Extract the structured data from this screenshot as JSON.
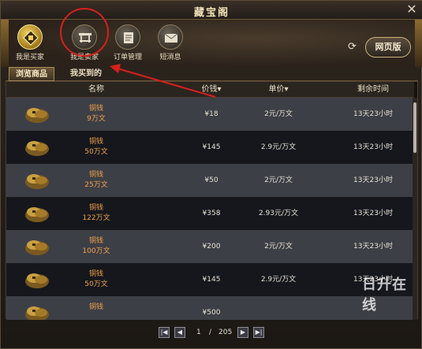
{
  "window": {
    "title": "藏宝阁",
    "close_glyph": "✕"
  },
  "toolbar": {
    "buttons": [
      {
        "label": "我是买家",
        "icon": "coin-icon",
        "active": true
      },
      {
        "label": "我是卖家",
        "icon": "stall-icon",
        "active": false
      },
      {
        "label": "订单管理",
        "icon": "book-icon",
        "active": false
      },
      {
        "label": "短消息",
        "icon": "envelope-icon",
        "active": false
      }
    ],
    "refresh_glyph": "⟳",
    "web_label": "网页版"
  },
  "tabs": [
    {
      "label": "浏览商品",
      "active": true
    },
    {
      "label": "我买到的",
      "active": false
    }
  ],
  "table": {
    "headers": {
      "name": "名称",
      "price": "价钱",
      "unit": "单价",
      "remain": "剩余时间"
    },
    "rows": [
      {
        "item": "铜钱",
        "qty": "9万文",
        "price": "¥18",
        "unit": "2元/万文",
        "remain": "13天23小时"
      },
      {
        "item": "铜钱",
        "qty": "50万文",
        "price": "¥145",
        "unit": "2.9元/万文",
        "remain": "13天23小时"
      },
      {
        "item": "铜钱",
        "qty": "25万文",
        "price": "¥50",
        "unit": "2元/万文",
        "remain": "13天23小时"
      },
      {
        "item": "铜钱",
        "qty": "122万文",
        "price": "¥358",
        "unit": "2.93元/万文",
        "remain": "13天23小时"
      },
      {
        "item": "铜钱",
        "qty": "100万文",
        "price": "¥200",
        "unit": "2元/万文",
        "remain": "13天23小时"
      },
      {
        "item": "铜钱",
        "qty": "50万文",
        "price": "¥145",
        "unit": "2.9元/万文",
        "remain": "13天23小时"
      },
      {
        "item": "铜钱",
        "qty": "",
        "price": "¥500",
        "unit": "",
        "remain": ""
      }
    ]
  },
  "pager": {
    "current": "1",
    "separator": "/",
    "total": "205"
  },
  "watermark": {
    "top": "日升在线",
    "bottom": ""
  },
  "colors": {
    "highlight": "#d8201c",
    "item_name": "#f0a14a",
    "accent_gold": "#f0d060"
  }
}
